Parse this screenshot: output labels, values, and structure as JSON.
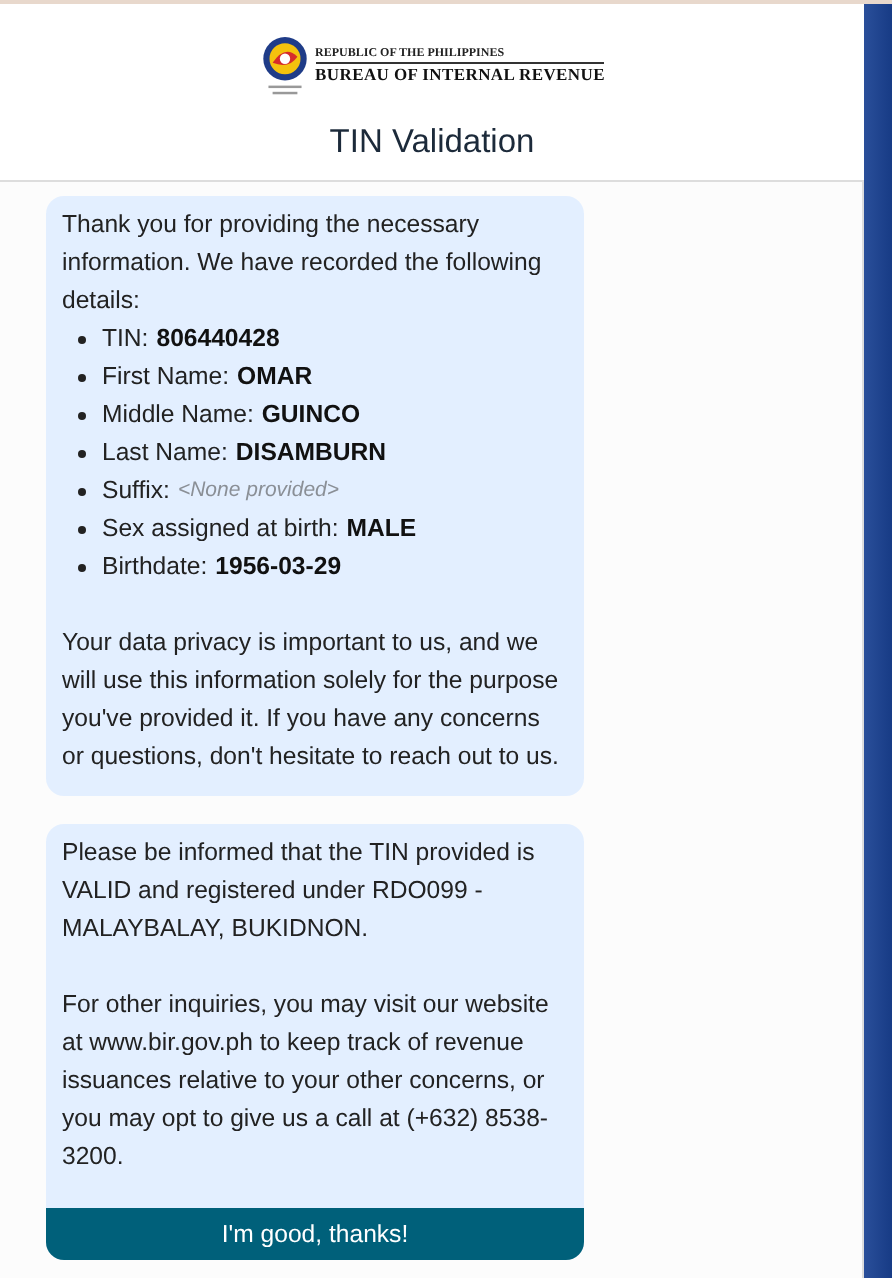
{
  "header": {
    "agency_top": "REPUBLIC OF THE PHILIPPINES",
    "agency_name": "BUREAU OF INTERNAL REVENUE",
    "title": "TIN Validation"
  },
  "messages": [
    {
      "intro": "Thank you for providing the necessary information. We have recorded the following details:",
      "details": [
        {
          "label": "TIN:",
          "value": "806440428",
          "provided": true
        },
        {
          "label": "First Name:",
          "value": "OMAR",
          "provided": true
        },
        {
          "label": "Middle Name:",
          "value": "GUINCO",
          "provided": true
        },
        {
          "label": "Last Name:",
          "value": "DISAMBURN",
          "provided": true
        },
        {
          "label": "Suffix:",
          "value": "<None provided>",
          "provided": false
        },
        {
          "label": "Sex assigned at birth:",
          "value": "MALE",
          "provided": true
        },
        {
          "label": "Birthdate:",
          "value": "1956-03-29",
          "provided": true
        }
      ],
      "paragraphs": [
        "Your data privacy is important to us, and we will use this information solely for the purpose you've provided it. If you have any concerns or questions, don't hesitate to reach out to us."
      ]
    },
    {
      "paragraphs": [
        "Please be informed that the TIN provided is VALID and registered under RDO099 - MALAYBALAY, BUKIDNON.",
        "For other inquiries, you may visit our website at www.bir.gov.ph to keep track of revenue issuances relative to your other concerns, or you may opt to give us a call at (+632) 8538-3200."
      ],
      "button": "I'm good, thanks!"
    }
  ]
}
